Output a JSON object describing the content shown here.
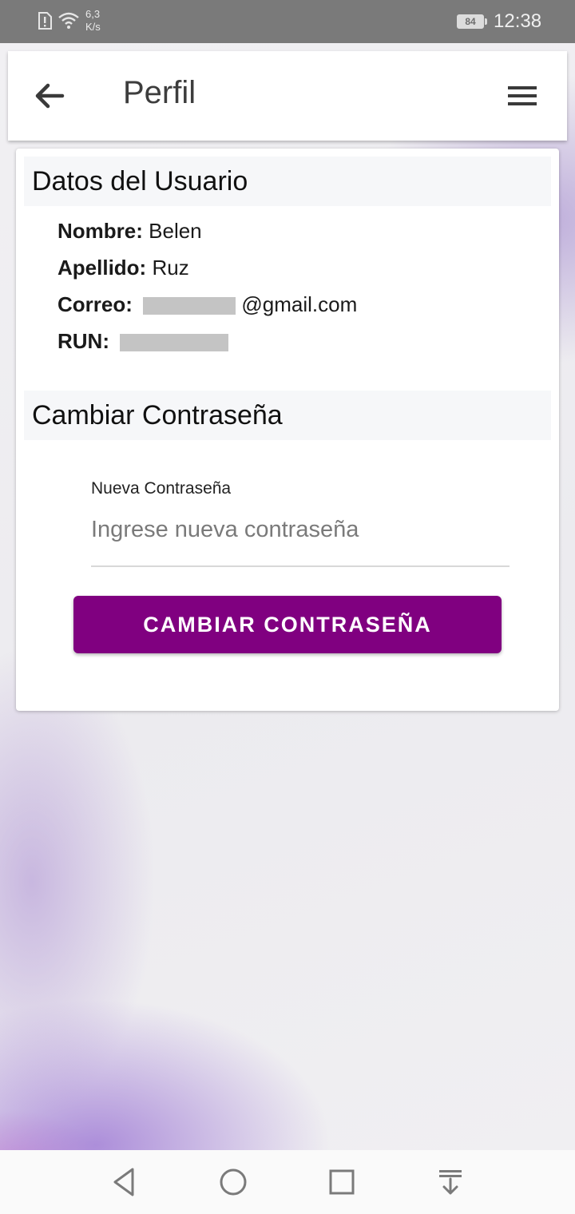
{
  "status_bar": {
    "speed_value": "6,3",
    "speed_unit": "K/s",
    "battery": "84",
    "time": "12:38"
  },
  "app_bar": {
    "title": "Perfil",
    "back_icon": "arrow-left-icon",
    "menu_icon": "hamburger-menu-icon"
  },
  "user_section": {
    "heading": "Datos del Usuario",
    "fields": [
      {
        "label": "Nombre:",
        "value": "Belen"
      },
      {
        "label": "Apellido:",
        "value": "Ruz"
      },
      {
        "label": "Correo:",
        "value": "@gmail.com"
      },
      {
        "label": "RUN:",
        "value": ""
      }
    ]
  },
  "password_section": {
    "heading": "Cambiar Contraseña",
    "field_label": "Nueva Contraseña",
    "placeholder": "Ingrese nueva contraseña",
    "value": "",
    "button_label": "CAMBIAR CONTRASEÑA"
  },
  "colors": {
    "accent": "#800080",
    "status_bar": "#7a7a7a"
  },
  "nav_bar": {
    "icons": [
      "back-triangle-icon",
      "home-circle-icon",
      "recents-square-icon",
      "notification-pull-icon"
    ]
  }
}
